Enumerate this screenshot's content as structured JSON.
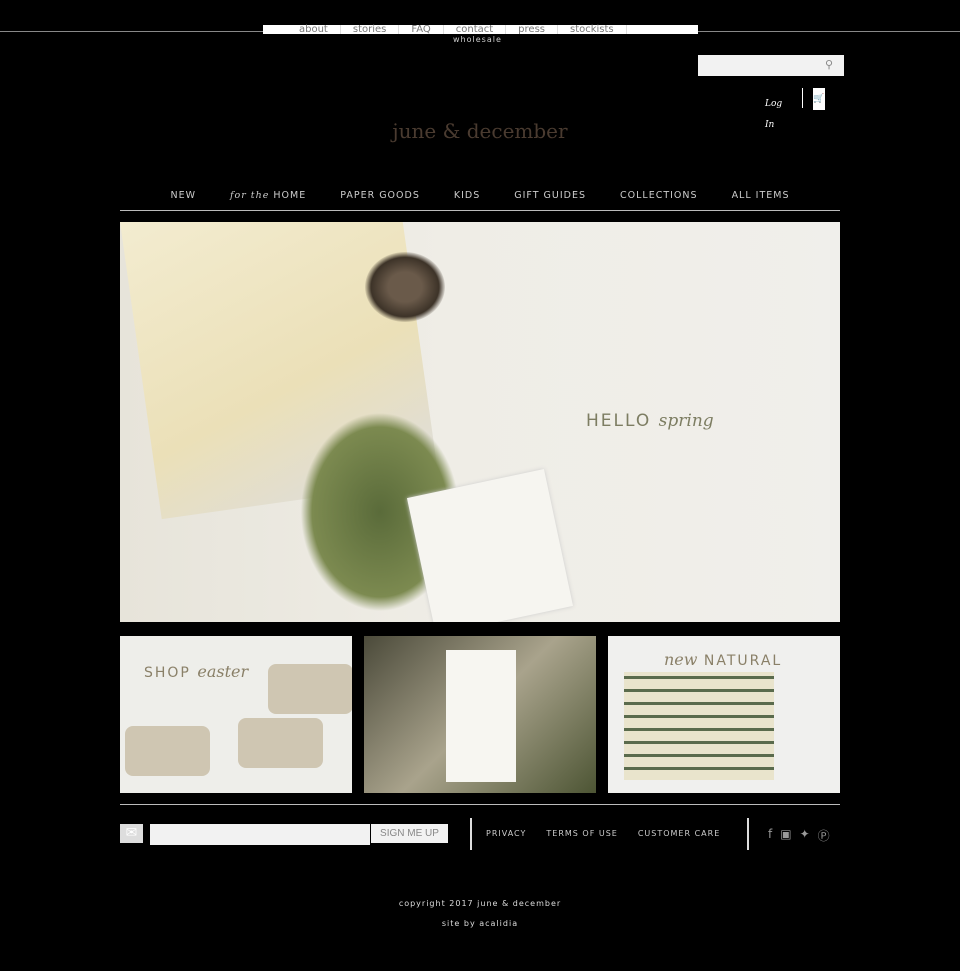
{
  "top_links": [
    "about",
    "stories",
    "FAQ",
    "contact",
    "press",
    "stockists"
  ],
  "wholesale": "wholesale",
  "search": {
    "placeholder": ""
  },
  "account": {
    "login": "Log In"
  },
  "logo": "june & december",
  "nav": [
    {
      "pre": "",
      "label": "NEW"
    },
    {
      "pre": "for the",
      "label": "HOME"
    },
    {
      "pre": "",
      "label": "PAPER GOODS"
    },
    {
      "pre": "",
      "label": "KIDS"
    },
    {
      "pre": "",
      "label": "GIFT GUIDES"
    },
    {
      "pre": "",
      "label": "COLLECTIONS"
    },
    {
      "pre": "",
      "label": "ALL ITEMS"
    }
  ],
  "hero": {
    "main": "HELLO",
    "accent": "spring"
  },
  "tiles": [
    {
      "main": "SHOP",
      "accent": "easter"
    },
    {
      "main": "",
      "accent": ""
    },
    {
      "main": "NATURAL",
      "accent": "new"
    }
  ],
  "newsletter": {
    "placeholder": "",
    "button": "SIGN ME UP"
  },
  "footer_links": [
    "PRIVACY",
    "TERMS OF USE",
    "CUSTOMER CARE"
  ],
  "social": [
    "facebook-icon",
    "instagram-icon",
    "twitter-icon",
    "pinterest-icon"
  ],
  "copyright": "copyright 2017 june & december",
  "credit": "site by acalidia"
}
